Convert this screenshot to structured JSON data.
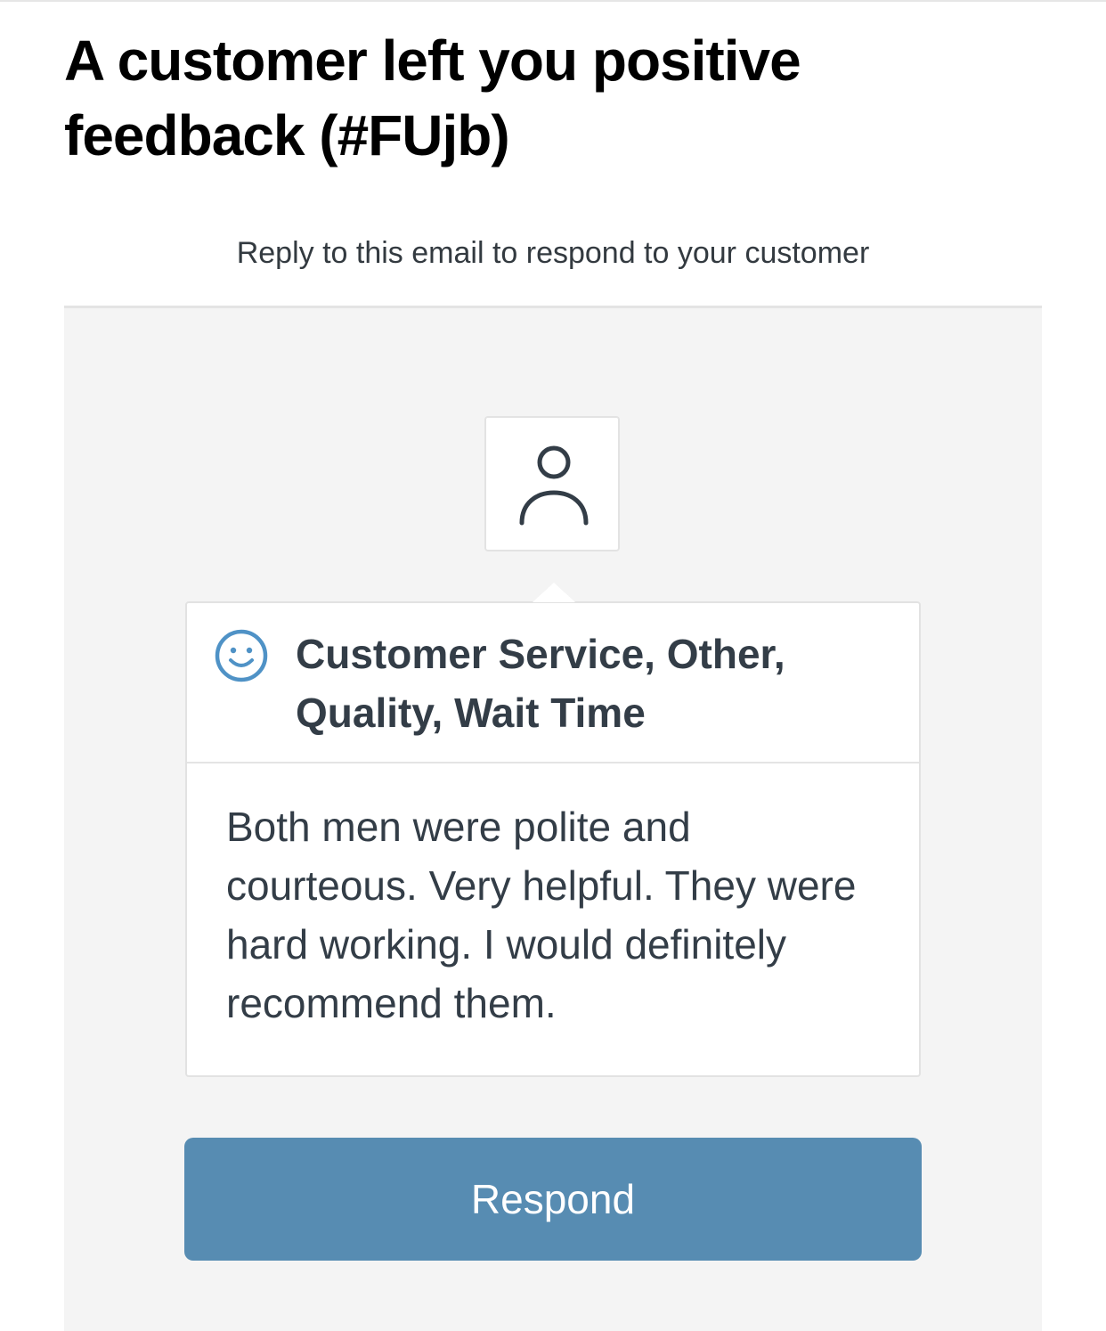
{
  "email": {
    "title": "A customer left you positive feedback (#FUjb)",
    "subtitle": "Reply to this email to respond to your customer"
  },
  "feedback": {
    "avatar_icon": "person-icon",
    "sentiment_icon": "smiley-face-icon",
    "tags": "Customer Service, Other, Quality, Wait Time",
    "comment": "Both men were polite and courteous. Very helpful. They were hard working. I would definitely recommend them."
  },
  "actions": {
    "respond_label": "Respond"
  },
  "colors": {
    "button": "#578cb2",
    "smiley": "#4f92c6",
    "text_dark": "#333d47",
    "panel_bg": "#f4f4f4"
  }
}
